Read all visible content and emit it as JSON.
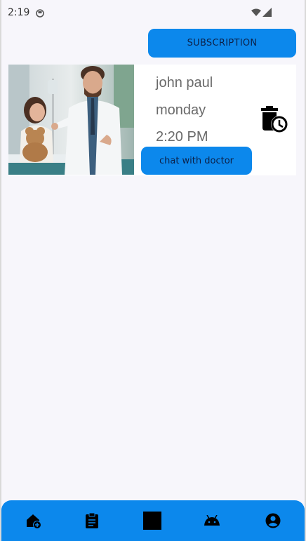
{
  "status_bar": {
    "time": "2:19",
    "icons": [
      "app-notification-icon",
      "wifi-icon",
      "cell-signal-icon"
    ]
  },
  "header": {
    "subscription_label": "SUBSCRIPTION"
  },
  "appointments": [
    {
      "doctor_name": "john paul",
      "day": "monday",
      "time": "2:20 PM",
      "photo": "doctor-with-child-photo",
      "delete_icon": "delete-schedule-icon",
      "chat_label": "chat with doctor"
    }
  ],
  "bottom_nav": {
    "items": [
      "home-add-icon",
      "clipboard-icon",
      "square-icon",
      "android-icon",
      "account-circle-icon"
    ]
  },
  "colors": {
    "accent": "#0c88ec",
    "button_text": "#0c2148",
    "background": "#f7f6fb",
    "card": "#ffffff"
  }
}
